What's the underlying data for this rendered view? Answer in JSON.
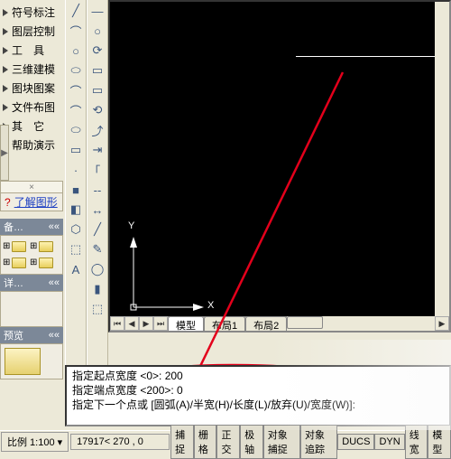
{
  "menu": {
    "items": [
      "符号标注",
      "图层控制",
      "工　具",
      "三维建模",
      "图块图案",
      "文件布图",
      "其　它",
      "帮助演示"
    ]
  },
  "nav": {
    "top_toggle": "×",
    "link_text": "了解图形"
  },
  "palette": {
    "backup_header": "备…",
    "backup_icon_chevrons": "««",
    "detail_header": "详…",
    "detail_header_chevrons": "««",
    "preview_header": "预览",
    "preview_header_chevrons": "««"
  },
  "toolbars": {
    "col1": [
      "╱",
      "⌒",
      "○",
      "⬭",
      "⌒",
      "⌒",
      "⬭",
      "▭",
      "·",
      "■",
      "◧",
      "⬡",
      "⬚",
      "A"
    ],
    "col2": [
      "—",
      "○",
      "⟳",
      "▭",
      "▭",
      "⟲",
      "⤴",
      "⇥",
      "｢ ",
      "--",
      "↔",
      "╱",
      "✎",
      "◯",
      "▮",
      "⬚"
    ]
  },
  "canvas": {
    "axis_x": "X",
    "axis_y": "Y",
    "tabs": [
      "模型",
      "布局1",
      "布局2"
    ],
    "scroll_left": "◀",
    "scroll_right": "▶",
    "scroll_first": "⏮",
    "scroll_last": "⏭"
  },
  "command": {
    "line1": "指定起点宽度 <0>: 200",
    "line2": "指定端点宽度 <200>: 0",
    "line3": "指定下一个点或 [圆弧(A)/半宽(H)/长度(L)/放弃(U)/宽度(W)]:"
  },
  "status": {
    "scale_label": "比例 1:100 ▾",
    "coords": "17917< 270 , 0",
    "buttons": [
      "捕捉",
      "栅格",
      "正交",
      "极轴",
      "对象捕捉",
      "对象追踪",
      "DUCS",
      "DYN",
      "线宽",
      "模型"
    ]
  }
}
